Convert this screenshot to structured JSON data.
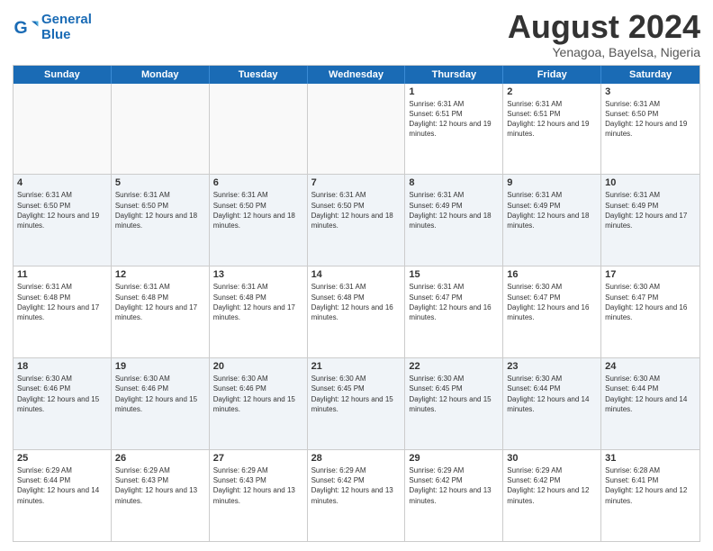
{
  "logo": {
    "line1": "General",
    "line2": "Blue"
  },
  "title": "August 2024",
  "subtitle": "Yenagoa, Bayelsa, Nigeria",
  "days_of_week": [
    "Sunday",
    "Monday",
    "Tuesday",
    "Wednesday",
    "Thursday",
    "Friday",
    "Saturday"
  ],
  "weeks": [
    [
      {
        "day": "",
        "empty": true
      },
      {
        "day": "",
        "empty": true
      },
      {
        "day": "",
        "empty": true
      },
      {
        "day": "",
        "empty": true
      },
      {
        "day": "1",
        "sunrise": "6:31 AM",
        "sunset": "6:51 PM",
        "daylight": "12 hours and 19 minutes."
      },
      {
        "day": "2",
        "sunrise": "6:31 AM",
        "sunset": "6:51 PM",
        "daylight": "12 hours and 19 minutes."
      },
      {
        "day": "3",
        "sunrise": "6:31 AM",
        "sunset": "6:50 PM",
        "daylight": "12 hours and 19 minutes."
      }
    ],
    [
      {
        "day": "4",
        "sunrise": "6:31 AM",
        "sunset": "6:50 PM",
        "daylight": "12 hours and 19 minutes."
      },
      {
        "day": "5",
        "sunrise": "6:31 AM",
        "sunset": "6:50 PM",
        "daylight": "12 hours and 18 minutes."
      },
      {
        "day": "6",
        "sunrise": "6:31 AM",
        "sunset": "6:50 PM",
        "daylight": "12 hours and 18 minutes."
      },
      {
        "day": "7",
        "sunrise": "6:31 AM",
        "sunset": "6:50 PM",
        "daylight": "12 hours and 18 minutes."
      },
      {
        "day": "8",
        "sunrise": "6:31 AM",
        "sunset": "6:49 PM",
        "daylight": "12 hours and 18 minutes."
      },
      {
        "day": "9",
        "sunrise": "6:31 AM",
        "sunset": "6:49 PM",
        "daylight": "12 hours and 18 minutes."
      },
      {
        "day": "10",
        "sunrise": "6:31 AM",
        "sunset": "6:49 PM",
        "daylight": "12 hours and 17 minutes."
      }
    ],
    [
      {
        "day": "11",
        "sunrise": "6:31 AM",
        "sunset": "6:48 PM",
        "daylight": "12 hours and 17 minutes."
      },
      {
        "day": "12",
        "sunrise": "6:31 AM",
        "sunset": "6:48 PM",
        "daylight": "12 hours and 17 minutes."
      },
      {
        "day": "13",
        "sunrise": "6:31 AM",
        "sunset": "6:48 PM",
        "daylight": "12 hours and 17 minutes."
      },
      {
        "day": "14",
        "sunrise": "6:31 AM",
        "sunset": "6:48 PM",
        "daylight": "12 hours and 16 minutes."
      },
      {
        "day": "15",
        "sunrise": "6:31 AM",
        "sunset": "6:47 PM",
        "daylight": "12 hours and 16 minutes."
      },
      {
        "day": "16",
        "sunrise": "6:30 AM",
        "sunset": "6:47 PM",
        "daylight": "12 hours and 16 minutes."
      },
      {
        "day": "17",
        "sunrise": "6:30 AM",
        "sunset": "6:47 PM",
        "daylight": "12 hours and 16 minutes."
      }
    ],
    [
      {
        "day": "18",
        "sunrise": "6:30 AM",
        "sunset": "6:46 PM",
        "daylight": "12 hours and 15 minutes."
      },
      {
        "day": "19",
        "sunrise": "6:30 AM",
        "sunset": "6:46 PM",
        "daylight": "12 hours and 15 minutes."
      },
      {
        "day": "20",
        "sunrise": "6:30 AM",
        "sunset": "6:46 PM",
        "daylight": "12 hours and 15 minutes."
      },
      {
        "day": "21",
        "sunrise": "6:30 AM",
        "sunset": "6:45 PM",
        "daylight": "12 hours and 15 minutes."
      },
      {
        "day": "22",
        "sunrise": "6:30 AM",
        "sunset": "6:45 PM",
        "daylight": "12 hours and 15 minutes."
      },
      {
        "day": "23",
        "sunrise": "6:30 AM",
        "sunset": "6:44 PM",
        "daylight": "12 hours and 14 minutes."
      },
      {
        "day": "24",
        "sunrise": "6:30 AM",
        "sunset": "6:44 PM",
        "daylight": "12 hours and 14 minutes."
      }
    ],
    [
      {
        "day": "25",
        "sunrise": "6:29 AM",
        "sunset": "6:44 PM",
        "daylight": "12 hours and 14 minutes."
      },
      {
        "day": "26",
        "sunrise": "6:29 AM",
        "sunset": "6:43 PM",
        "daylight": "12 hours and 13 minutes."
      },
      {
        "day": "27",
        "sunrise": "6:29 AM",
        "sunset": "6:43 PM",
        "daylight": "12 hours and 13 minutes."
      },
      {
        "day": "28",
        "sunrise": "6:29 AM",
        "sunset": "6:42 PM",
        "daylight": "12 hours and 13 minutes."
      },
      {
        "day": "29",
        "sunrise": "6:29 AM",
        "sunset": "6:42 PM",
        "daylight": "12 hours and 13 minutes."
      },
      {
        "day": "30",
        "sunrise": "6:29 AM",
        "sunset": "6:42 PM",
        "daylight": "12 hours and 12 minutes."
      },
      {
        "day": "31",
        "sunrise": "6:28 AM",
        "sunset": "6:41 PM",
        "daylight": "12 hours and 12 minutes."
      }
    ]
  ]
}
